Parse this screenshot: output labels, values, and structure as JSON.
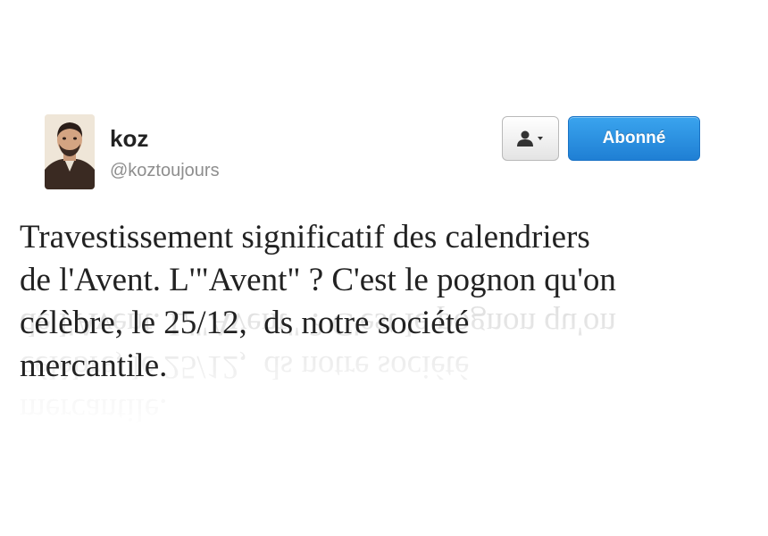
{
  "user": {
    "name": "koz",
    "handle": "@koztoujours"
  },
  "actions": {
    "user_menu_icon": "person-icon",
    "follow_label": "Abonné"
  },
  "tweet": {
    "lines": [
      "Travestissement significatif des calendriers",
      "de l'Avent. L'\"Avent\" ? C'est le pognon qu'on",
      "célèbre, le 25/12,  ds notre société",
      "mercantile."
    ]
  },
  "colors": {
    "follow_button": "#2a8de0",
    "text": "#222222",
    "handle": "#8e8e8e"
  }
}
